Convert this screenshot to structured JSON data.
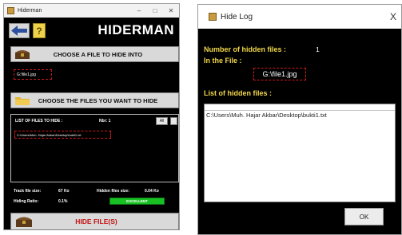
{
  "hiderman": {
    "window_title": "Hiderman",
    "window_controls": [
      "–",
      "□",
      "✕"
    ],
    "logo": "HIDERMAN",
    "help_label": "?",
    "choose_file_button": "CHOOSE A FILE TO HIDE INTO",
    "selected_file": "G:\\file1.jpg",
    "choose_files_button": "CHOOSE THE FILES YOU WANT TO HIDE",
    "list_title": "LIST OF FILES TO HIDE :",
    "nbr_label": "Nbr: 1",
    "all_button": "All",
    "list_items": [
      "C:\\Users\\Muh. Hajar Akbar\\Desktop\\bukti1.txt"
    ],
    "stats": {
      "track_file_size_label": "Track file size:",
      "track_file_size_value": "67 Ko",
      "hidden_files_size_label": "Hidden files size:",
      "hidden_files_size_value": "0.04 Ko",
      "hiding_ratio_label": "Hiding Ratio:",
      "hiding_ratio_value": "0.1%",
      "rating": "EXCELLENT"
    },
    "hide_button": "HIDE FILE(S)"
  },
  "hide_log": {
    "window_title": "Hide Log",
    "close_label": "X",
    "hidden_count_label": "Number of hidden files :",
    "hidden_count": "1",
    "in_file_label": "In the File :",
    "in_file_value": "G:\\file1.jpg",
    "list_label": "List of hidden files :",
    "list_items": [
      "C:\\Users\\Muh. Hajar Akbar\\Desktop\\bukti1.txt"
    ],
    "ok_button": "OK"
  },
  "colors": {
    "background": "#000000",
    "log_label": "#f2d84a",
    "highlight_dash": "#d11a1a",
    "rating": "#19c024",
    "hide_text": "#c31010"
  }
}
